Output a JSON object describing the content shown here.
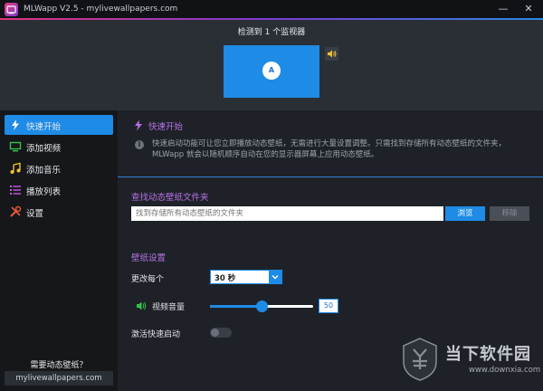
{
  "window": {
    "title": "MLWapp V2.5 - mylivewallpapers.com",
    "minimize_glyph": "—",
    "close_glyph": "✕"
  },
  "monitors": {
    "detected_text": "检测到 1 个监视器",
    "monitor_label": "A",
    "speaker_icon": "speaker-icon"
  },
  "sidebar": {
    "items": [
      {
        "label": "快速开始",
        "icon": "lightning-icon",
        "active": true
      },
      {
        "label": "添加视频",
        "icon": "monitor-icon",
        "active": false
      },
      {
        "label": "添加音乐",
        "icon": "music-icon",
        "active": false
      },
      {
        "label": "播放列表",
        "icon": "list-icon",
        "active": false
      },
      {
        "label": "设置",
        "icon": "tools-icon",
        "active": false
      }
    ],
    "promo_text": "需要动态壁纸？",
    "promo_link": "mylivewallpapers.com"
  },
  "quickstart": {
    "title": "快速开始",
    "description": "快速启动功能可让您立即播放动态壁纸，无需进行大量设置调整。只需找到存储所有动态壁纸的文件夹，MLWapp 就会以随机顺序自动在您的显示器屏幕上应用动态壁纸。"
  },
  "folder": {
    "title": "查找动态壁纸文件夹",
    "placeholder": "找到存储所有动态壁纸的文件夹",
    "browse_label": "浏览",
    "remove_label": "移除"
  },
  "settings": {
    "title": "壁纸设置",
    "change_every_label": "更改每个",
    "change_every_value": "30 秒",
    "video_volume_label": "视频音量",
    "video_volume_value": "50",
    "volume_fraction": 0.5,
    "autostart_label": "激活快速启动",
    "autostart_on": false
  },
  "watermark": {
    "brand": "当下软件园",
    "url": "www.downxia.com"
  },
  "colors": {
    "accent": "#1e8be6",
    "section_title": "#b872e8",
    "background": "#1e2228",
    "sidebar": "#15171b"
  }
}
